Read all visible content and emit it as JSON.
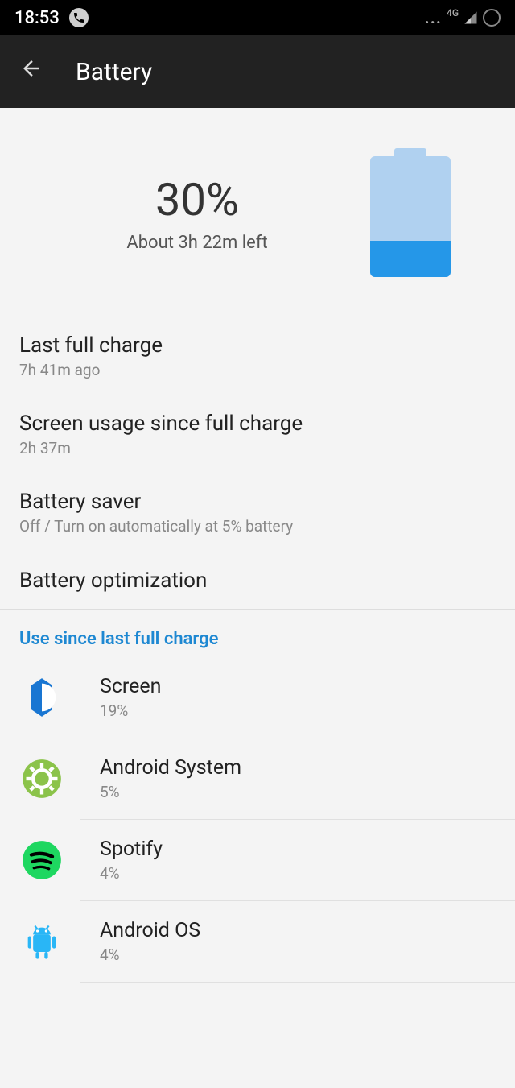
{
  "status": {
    "time": "18:53",
    "dots": "...",
    "network": "4G"
  },
  "header": {
    "title": "Battery"
  },
  "hero": {
    "percentage": "30%",
    "remaining": "About 3h 22m left",
    "fill_percent": 30
  },
  "rows": {
    "last_charge": {
      "title": "Last full charge",
      "sub": "7h 41m ago"
    },
    "screen_usage": {
      "title": "Screen usage since full charge",
      "sub": "2h 37m"
    },
    "saver": {
      "title": "Battery saver",
      "sub": "Off / Turn on automatically at 5% battery"
    },
    "optimization": {
      "title": "Battery optimization"
    }
  },
  "section_header": "Use since last full charge",
  "usage": [
    {
      "name": "Screen",
      "percent": "19%",
      "icon": "screen-icon"
    },
    {
      "name": "Android System",
      "percent": "5%",
      "icon": "system-icon"
    },
    {
      "name": "Spotify",
      "percent": "4%",
      "icon": "spotify-icon"
    },
    {
      "name": "Android OS",
      "percent": "4%",
      "icon": "android-icon"
    }
  ]
}
